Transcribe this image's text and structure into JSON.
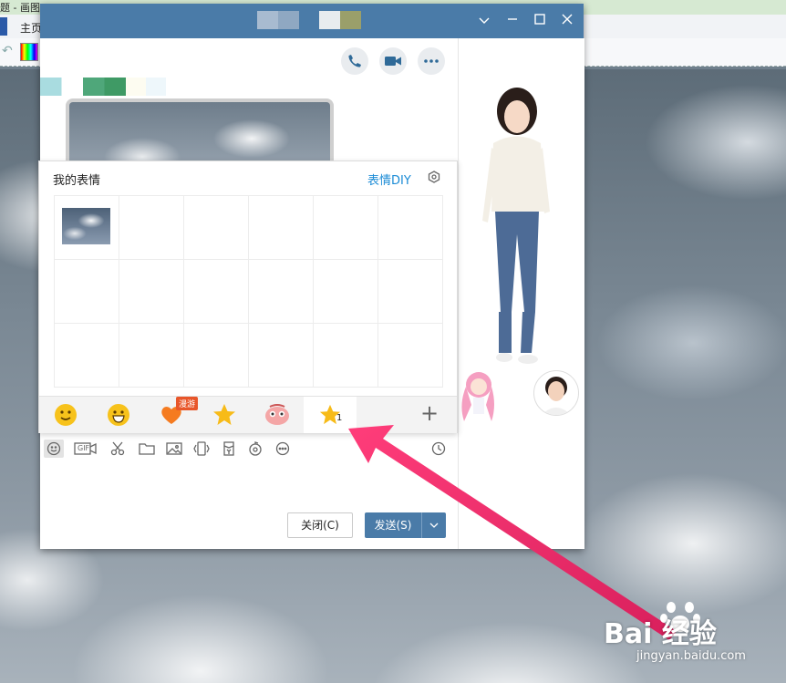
{
  "paint": {
    "title_fragment": "题 - 画图",
    "home_tab": "主页"
  },
  "chat_window": {
    "controls": {
      "dropdown": "chevron-down-icon",
      "minimize": "minimize-icon",
      "maximize": "maximize-icon",
      "close": "close-icon"
    },
    "header_actions": [
      "phone-icon",
      "video-icon",
      "more-icon"
    ]
  },
  "emoji_panel": {
    "title": "我的表情",
    "diy_link": "表情DIY",
    "grid": {
      "rows": 3,
      "columns": 6,
      "filled_cells": 1
    },
    "tabs": [
      {
        "icon": "smile-face-icon",
        "badge": ""
      },
      {
        "icon": "grin-face-icon",
        "badge": ""
      },
      {
        "icon": "heart-icon",
        "badge": "漫游"
      },
      {
        "icon": "star-icon",
        "badge": ""
      },
      {
        "icon": "cartoon-face-icon",
        "badge": ""
      },
      {
        "icon": "favorite-star-icon",
        "badge": "1",
        "active": true
      }
    ],
    "add_label": "+"
  },
  "toolbar": {
    "tools": [
      "emoji-icon",
      "gif-icon",
      "scissors-icon",
      "folder-icon",
      "image-icon",
      "shake-icon",
      "red-packet-icon",
      "music-icon",
      "more-icon"
    ],
    "gif_label": "GIF",
    "history_icon": "clock-icon"
  },
  "buttons": {
    "close_label": "关闭(C)",
    "send_label": "发送(S)"
  },
  "watermark": {
    "logo": "Bai 经验",
    "url": "jingyan.baidu.com"
  },
  "colors": {
    "titlebar": "#4a7ba8",
    "accent_link": "#1a8bd6",
    "arrow": "#e8336d",
    "send_button": "#4a7ba8"
  }
}
